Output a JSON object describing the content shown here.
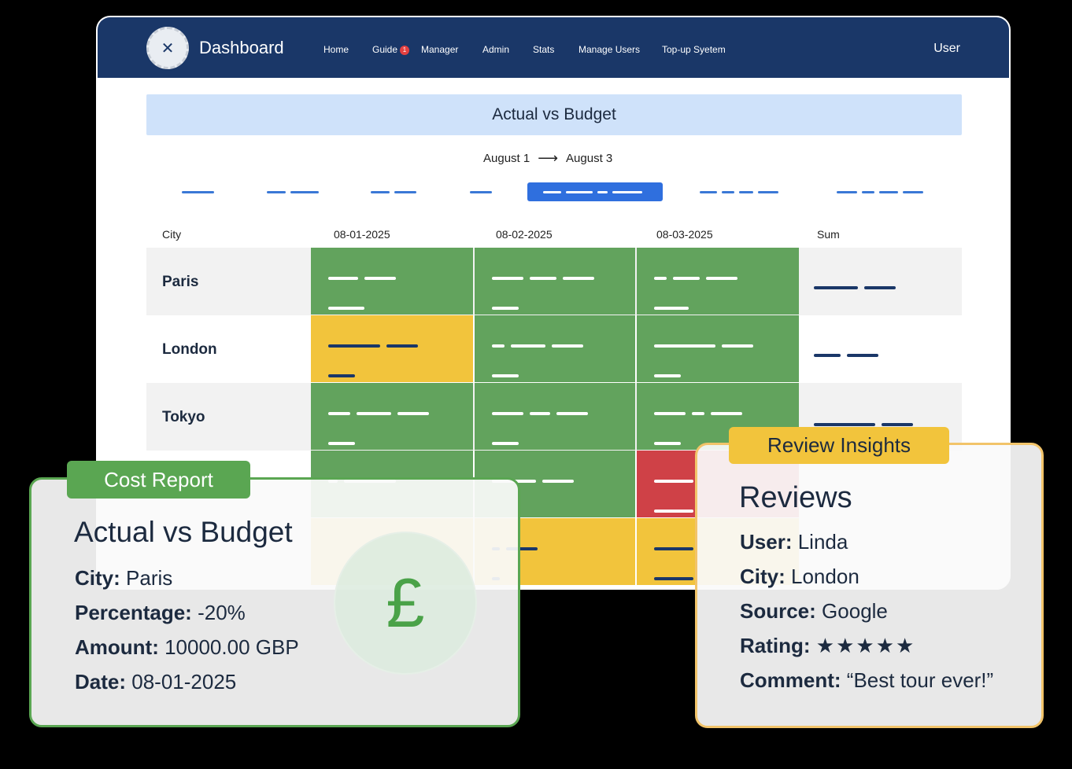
{
  "navbar": {
    "brand": "Dashboard",
    "items": [
      "Home",
      "Guide",
      "Manager",
      "Admin",
      "Stats",
      "Manage Users",
      "Top-up Syetem"
    ],
    "guide_badge": "1",
    "user": "User"
  },
  "page": {
    "title": "Actual vs Budget",
    "date_from": "August 1",
    "date_to": "August 3"
  },
  "table": {
    "headers": [
      "City",
      "08-01-2025",
      "08-02-2025",
      "08-03-2025",
      "Sum"
    ],
    "rows": [
      {
        "city": "Paris",
        "status": [
          "green",
          "green",
          "green"
        ]
      },
      {
        "city": "London",
        "status": [
          "yellow",
          "green",
          "green"
        ]
      },
      {
        "city": "Tokyo",
        "status": [
          "green",
          "green",
          "green"
        ]
      },
      {
        "city": "",
        "status": [
          "green",
          "green",
          "red"
        ]
      },
      {
        "city": "",
        "status": [
          "yellow",
          "yellow",
          "yellow"
        ]
      }
    ]
  },
  "colors": {
    "navy": "#1a3768",
    "green": "#62a35d",
    "yellow": "#f2c43c",
    "red": "#cf4147",
    "accent": "#2f6fde"
  },
  "cost_card": {
    "tag": "Cost Report",
    "title": "Actual vs Budget",
    "city_label": "City:",
    "city": "Paris",
    "percentage_label": "Percentage:",
    "percentage": "-20%",
    "amount_label": "Amount:",
    "amount": "10000.00 GBP",
    "date_label": "Date:",
    "date": "08-01-2025",
    "icon": "£"
  },
  "review_card": {
    "tag": "Review Insights",
    "title": "Reviews",
    "user_label": "User:",
    "user": "Linda",
    "city_label": "City:",
    "city": "London",
    "source_label": "Source:",
    "source": "Google",
    "rating_label": "Rating:",
    "rating": "★★★★★",
    "comment_label": "Comment:",
    "comment": "“Best tour ever!”"
  }
}
